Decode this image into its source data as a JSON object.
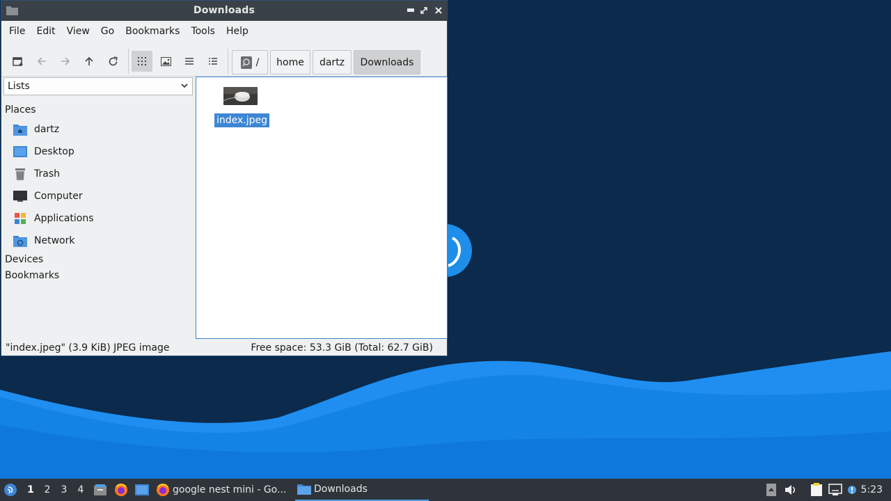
{
  "window": {
    "title": "Downloads",
    "menus": [
      "File",
      "Edit",
      "View",
      "Go",
      "Bookmarks",
      "Tools",
      "Help"
    ],
    "toolbar_icons": [
      "new-tab-icon",
      "back-arrow-icon",
      "forward-arrow-icon",
      "up-arrow-icon",
      "reload-icon",
      "icon-view-icon",
      "thumbnail-view-icon",
      "compact-view-icon",
      "detailed-list-view-icon"
    ],
    "breadcrumbs": [
      "/",
      "home",
      "dartz",
      "Downloads"
    ]
  },
  "sidebar": {
    "mode": "Lists",
    "places_heading": "Places",
    "places": [
      {
        "label": "dartz",
        "icon": "home-folder-icon"
      },
      {
        "label": "Desktop",
        "icon": "desktop-icon"
      },
      {
        "label": "Trash",
        "icon": "trash-icon"
      },
      {
        "label": "Computer",
        "icon": "computer-icon"
      },
      {
        "label": "Applications",
        "icon": "applications-icon"
      },
      {
        "label": "Network",
        "icon": "network-icon"
      }
    ],
    "devices_heading": "Devices",
    "bookmarks_heading": "Bookmarks"
  },
  "files": [
    {
      "name": "index.jpeg",
      "selected": true
    }
  ],
  "status": {
    "left": "\"index.jpeg\" (3.9 KiB) JPEG image",
    "right": "Free space: 53.3 GiB (Total: 62.7 GiB)"
  },
  "panel": {
    "workspaces": [
      "1",
      "2",
      "3",
      "4"
    ],
    "active_workspace": "1",
    "tasks": [
      {
        "label": "google nest mini - Go...",
        "icon": "firefox-icon"
      },
      {
        "label": "Downloads",
        "icon": "folder-icon",
        "active": true
      }
    ],
    "clock": "5:23"
  },
  "colors": {
    "selection": "#3d86d4",
    "titlebar": "#3a4148",
    "panel": "#2f343a",
    "desktop_dark": "#0b2a4c",
    "desktop_wave": "#1e8ee8"
  }
}
